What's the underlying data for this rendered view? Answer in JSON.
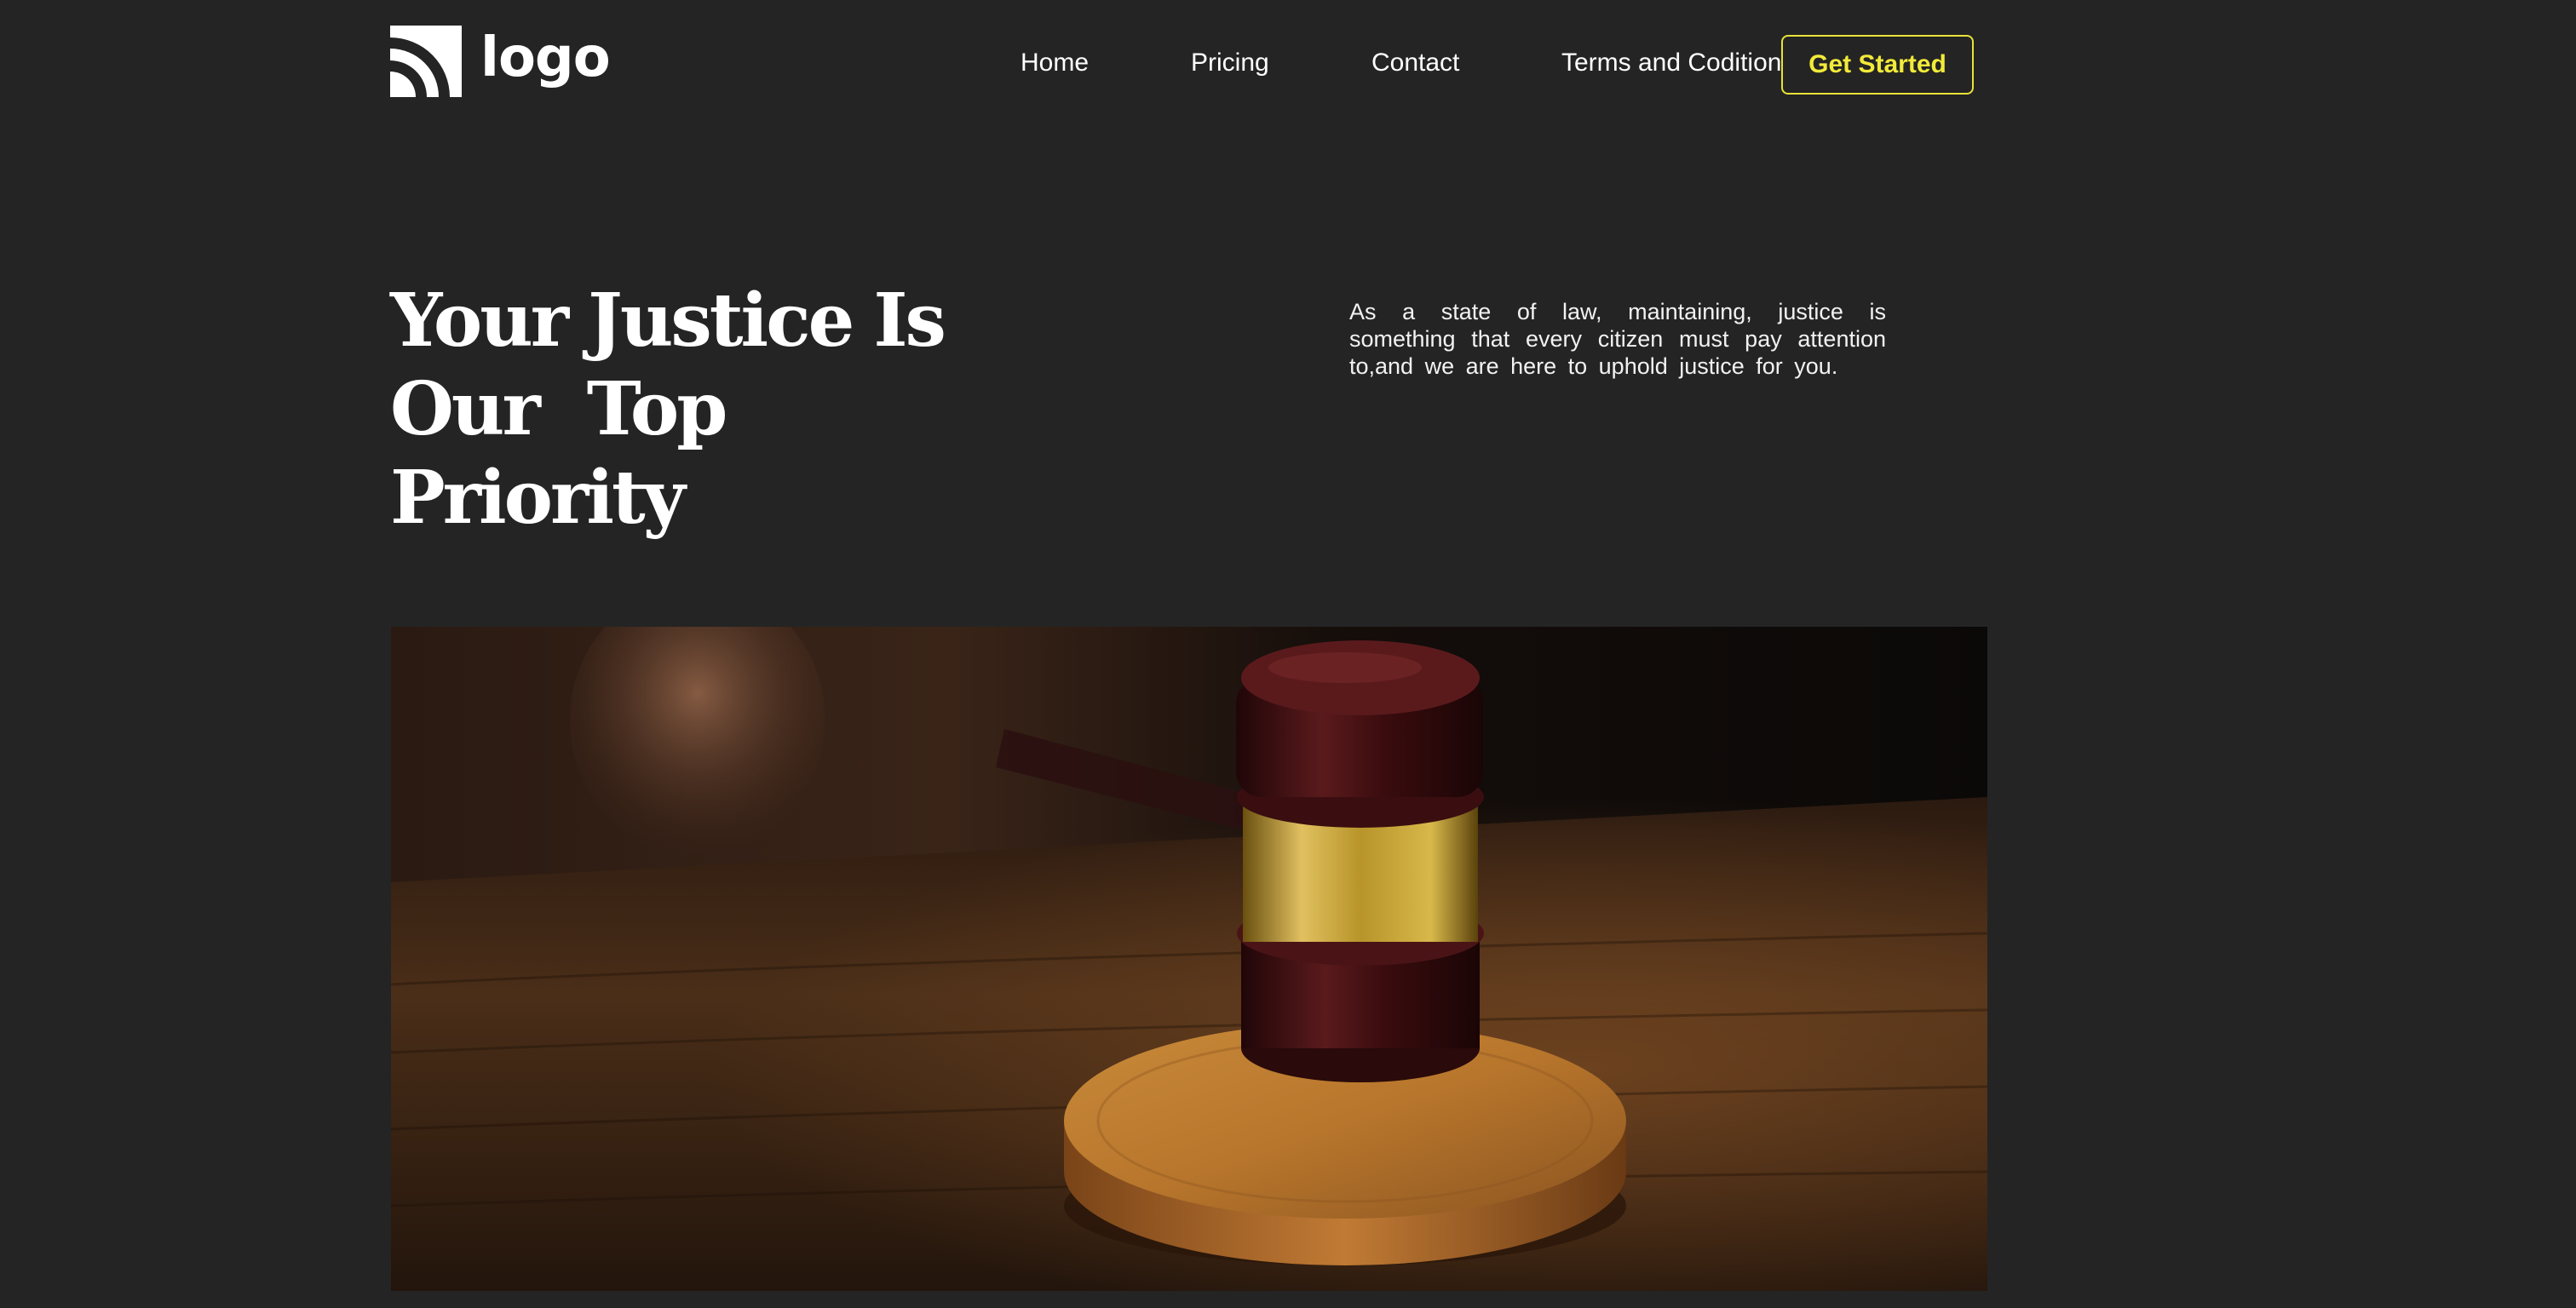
{
  "header": {
    "logo_text": "logo",
    "nav": {
      "home": "Home",
      "pricing": "Pricing",
      "contact": "Contact",
      "terms": "Terms and Codition"
    },
    "cta_label": "Get Started"
  },
  "hero": {
    "title_words": {
      "w1": "Your",
      "w2": "Justice",
      "w3": "Is",
      "w4": "Our",
      "w5": "Top",
      "w6": "Priority"
    },
    "description": "As a state of law, maintaining, justice is something that every citizen must pay attention to,and we are here to uphold justice for you.",
    "image_icon": "gavel-photo"
  },
  "colors": {
    "background": "#242424",
    "accent": "#e8e23a",
    "text": "#ffffff"
  }
}
